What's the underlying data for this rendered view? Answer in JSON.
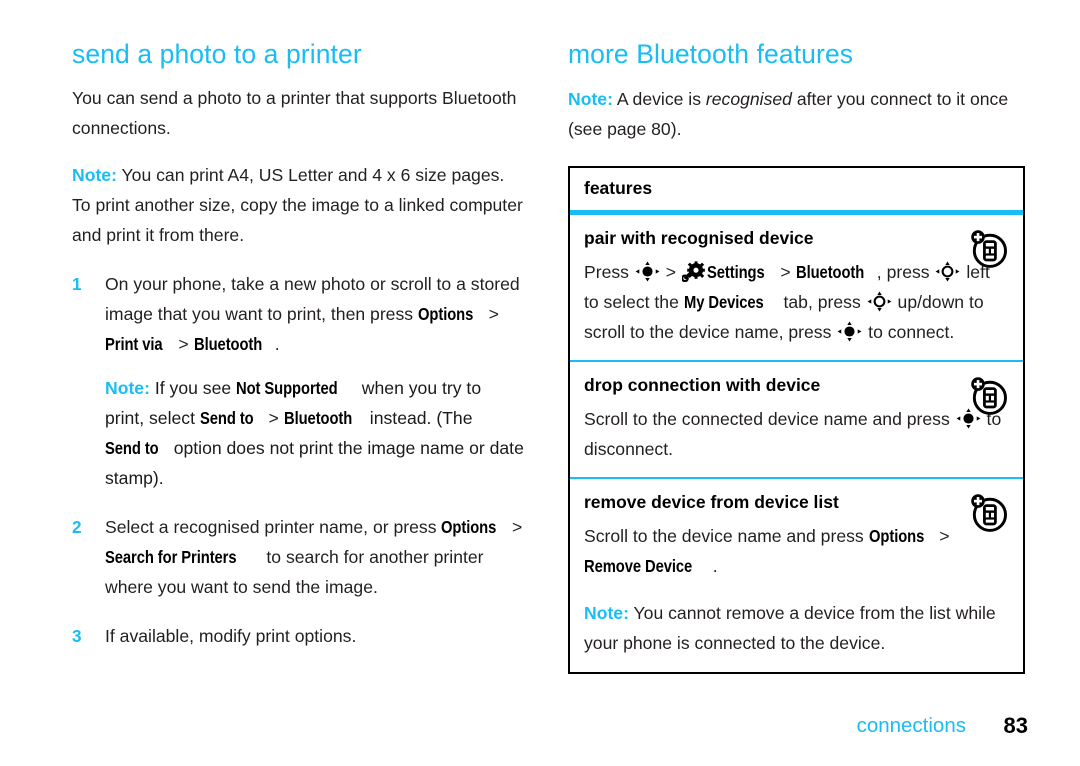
{
  "left_column": {
    "title": "send a photo to a printer",
    "intro": "You can send a photo to a printer that supports Bluetooth connections.",
    "note_label": "Note:",
    "note_1_text": " You can print A4, US Letter and 4 x 6 size pages. To print another size, copy the image to a linked computer and print it from there.",
    "steps": [
      {
        "num": "1",
        "text_a": "On your phone, take a new photo or scroll to a stored image that you want to print, then press ",
        "ui_1": "Options",
        "sep_1": " > ",
        "ui_2": "Print via",
        "sep_2": " > ",
        "ui_3": "Bluetooth",
        "text_b": "."
      },
      {
        "num": "2",
        "text_a": "Select a recognised printer name, or press ",
        "ui_1": "Options",
        "sep_1": " > ",
        "ui_2": "Search for Printers",
        "text_b": " to search for another printer where you want to send the image."
      },
      {
        "num": "3",
        "text_a": "If available, modify print options."
      }
    ],
    "substep_note": {
      "label": "Note:",
      "t1": " If you see ",
      "ui_1": "Not Supported",
      "t2": " when you try to print, select ",
      "ui_2": "Send to",
      "t3": " > ",
      "ui_3": "Bluetooth",
      "t4": " instead. (The ",
      "ui_4": "Send to",
      "t5": " option does not print the image name or date stamp)."
    }
  },
  "right_column": {
    "title": "more Bluetooth features",
    "note_label": "Note:",
    "note_t1": " A device is ",
    "note_italic": "recognised",
    "note_t2": " after you connect to it once (see page 80).",
    "table": {
      "header": "features",
      "rows": [
        {
          "title": "pair with recognised device",
          "icon": "add-device-icon",
          "body_parts": [
            {
              "type": "text",
              "v": "Press "
            },
            {
              "type": "key",
              "v": "center-select-key-icon"
            },
            {
              "type": "text",
              "v": " > "
            },
            {
              "type": "gear",
              "v": "settings-gear-icon"
            },
            {
              "type": "ui",
              "v": "Settings"
            },
            {
              "type": "text",
              "v": " > "
            },
            {
              "type": "ui",
              "v": "Bluetooth"
            },
            {
              "type": "text",
              "v": ", press "
            },
            {
              "type": "key",
              "v": "navigation-key-icon"
            },
            {
              "type": "text",
              "v": " left to select the "
            },
            {
              "type": "ui",
              "v": "My Devices"
            },
            {
              "type": "text",
              "v": " tab, press "
            },
            {
              "type": "key",
              "v": "navigation-key-icon"
            },
            {
              "type": "text",
              "v": " up/down to scroll to the device name, press "
            },
            {
              "type": "key",
              "v": "center-select-key-icon"
            },
            {
              "type": "text",
              "v": " to connect."
            }
          ]
        },
        {
          "title": "drop connection with device",
          "icon": "add-device-icon",
          "body_parts": [
            {
              "type": "text",
              "v": "Scroll to the connected device name and press "
            },
            {
              "type": "key",
              "v": "center-select-key-icon"
            },
            {
              "type": "text",
              "v": " to disconnect."
            }
          ]
        },
        {
          "title": "remove device from device list",
          "icon": "add-device-icon",
          "body_parts": [
            {
              "type": "text",
              "v": "Scroll to the device name and press "
            },
            {
              "type": "ui",
              "v": "Options"
            },
            {
              "type": "text",
              "v": " > "
            },
            {
              "type": "ui",
              "v": "Remove Device"
            },
            {
              "type": "text",
              "v": "."
            }
          ],
          "note": {
            "label": "Note:",
            "text": " You cannot remove a device from the list while your phone is connected to the device."
          }
        }
      ]
    }
  },
  "footer": {
    "chapter": "connections",
    "page_number": "83"
  },
  "colors": {
    "accent_cyan": "#19bdf4",
    "body_text": "#231f20",
    "rule_black": "#000000"
  }
}
